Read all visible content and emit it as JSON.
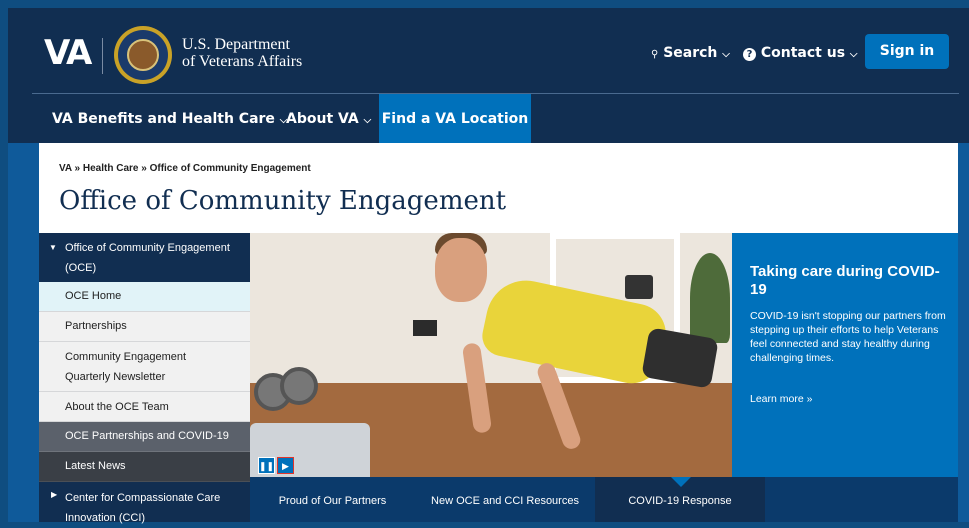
{
  "header": {
    "logo_text": "VA",
    "dept_line1": "U.S. Department",
    "dept_line2": "of Veterans Affairs",
    "search_label": "Search",
    "contact_label": "Contact us",
    "signin_label": "Sign in"
  },
  "nav": {
    "items": [
      {
        "label": "VA Benefits and Health Care"
      },
      {
        "label": "About VA"
      },
      {
        "label": "Find a VA Location"
      }
    ]
  },
  "breadcrumb": "VA » Health Care » Office of Community Engagement",
  "page_title": "Office of Community Engagement",
  "sidebar": {
    "parent_label": "Office of Community Engagement (OCE)",
    "items": [
      {
        "label": "OCE Home"
      },
      {
        "label": "Partnerships"
      },
      {
        "label": "Community Engagement Quarterly Newsletter"
      },
      {
        "label": "About the OCE Team"
      },
      {
        "label": "OCE Partnerships and COVID-19"
      },
      {
        "label": "Latest News"
      },
      {
        "label": "Center for Compassionate Care Innovation (CCI)"
      }
    ]
  },
  "promo": {
    "title": "Taking care during COVID-19",
    "body": "COVID-19 isn't stopping our partners from stepping up their efforts to help Veterans feel connected and stay healthy during challenging times.",
    "link": "Learn more »"
  },
  "tabs": [
    {
      "label": "Proud of Our Partners"
    },
    {
      "label": "New OCE and CCI Resources"
    },
    {
      "label": "COVID-19 Response"
    }
  ],
  "colors": {
    "header_bg": "#112e51",
    "accent_blue": "#0071bb",
    "content_bg": "#0f5a9a"
  }
}
